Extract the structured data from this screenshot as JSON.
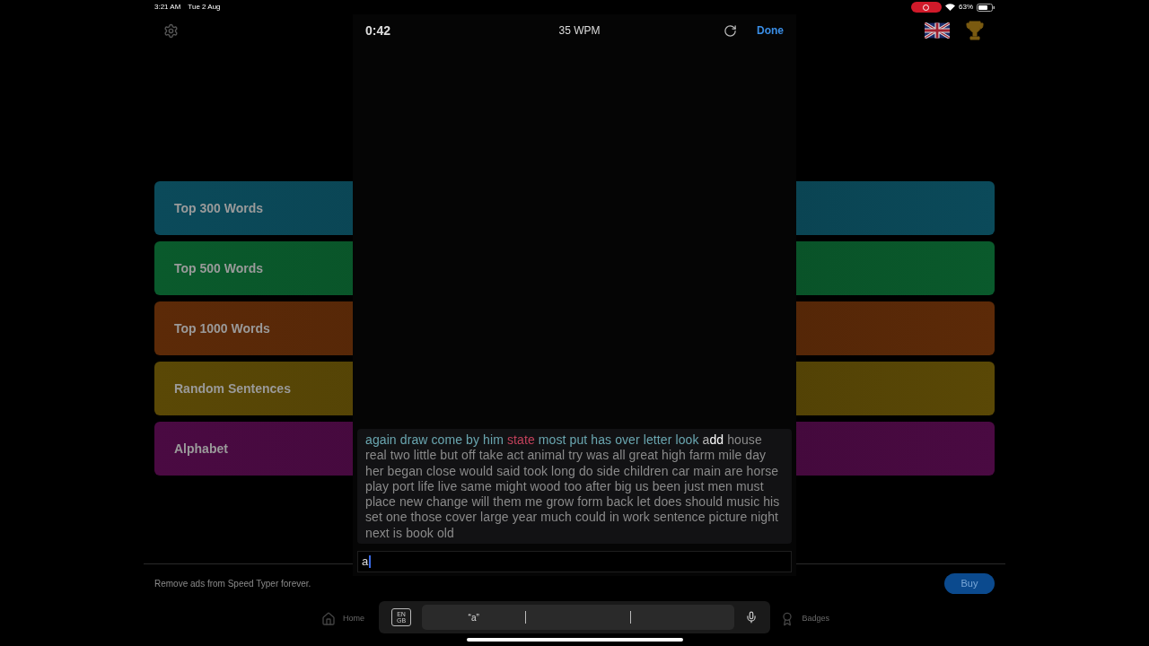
{
  "status_bar": {
    "time": "3:21 AM",
    "date": "Tue 2 Aug",
    "battery": "63%"
  },
  "modes": [
    {
      "label": "Top 300 Words",
      "color": "#0b4a5a"
    },
    {
      "label": "Top 500 Words",
      "color": "#0a5a2c"
    },
    {
      "label": "Top 1000 Words",
      "color": "#5c2a08"
    },
    {
      "label": "Random Sentences",
      "color": "#5a4806"
    },
    {
      "label": "Alphabet",
      "color": "#4a0a42"
    }
  ],
  "promo": {
    "text": "Remove ads from Speed Typer forever.",
    "button": "Buy"
  },
  "tab_bar": [
    {
      "label": "Home",
      "kind": "home"
    },
    {
      "label": "Badges",
      "kind": "badges"
    }
  ],
  "test": {
    "timer": "0:42",
    "speed": "35 WPM",
    "done": "Done",
    "passage": [
      {
        "text": "again draw come by him ",
        "kind": "correct"
      },
      {
        "text": "state",
        "kind": "wrong"
      },
      {
        "text": " most put has over letter look ",
        "kind": "correct"
      },
      {
        "text": "a",
        "kind": "typed"
      },
      {
        "text": "dd",
        "kind": "current"
      },
      {
        "text": " house real two little but off take act animal try was all great high farm mile day her began close would said took long do side children car main are horse play port life live same might wood too after big us been just men must place new change will them me grow form back let does should music his set one those cover large year much could in work sentence picture night next is book old",
        "kind": "pending"
      }
    ],
    "input": "a"
  },
  "keyboard_bar": {
    "language": [
      "EN",
      "GB"
    ],
    "suggestions": [
      "“a”"
    ]
  }
}
